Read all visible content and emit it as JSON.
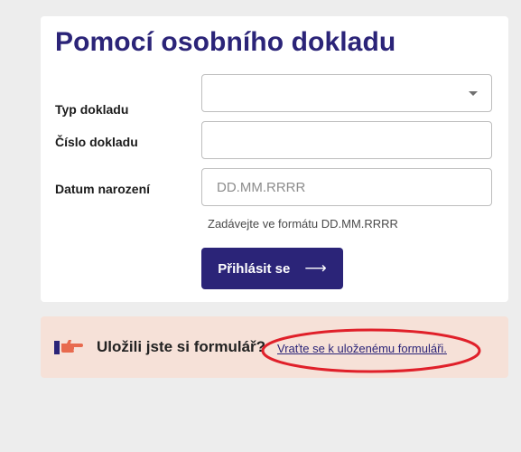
{
  "form": {
    "title": "Pomocí osobního dokladu",
    "fields": {
      "doc_type": {
        "label": "Typ dokladu",
        "value": ""
      },
      "doc_number": {
        "label": "Číslo dokladu",
        "value": ""
      },
      "birth_date": {
        "label": "Datum narození",
        "value": "",
        "placeholder": "DD.MM.RRRR",
        "hint": "Zadávejte ve formátu DD.MM.RRRR"
      }
    },
    "submit": {
      "label": "Přihlásit se",
      "icon": "arrow-right-icon",
      "icon_glyph": "⟶"
    }
  },
  "saved_form": {
    "icon": "pointing-hand-icon",
    "question": "Uložili jste si formulář?",
    "link": "Vraťte se k uloženému formuláři."
  },
  "colors": {
    "brand": "#2b2478",
    "saved_background": "#f6e1d8",
    "hand_icon": "#e86a4e",
    "annotation": "#e0202a"
  }
}
